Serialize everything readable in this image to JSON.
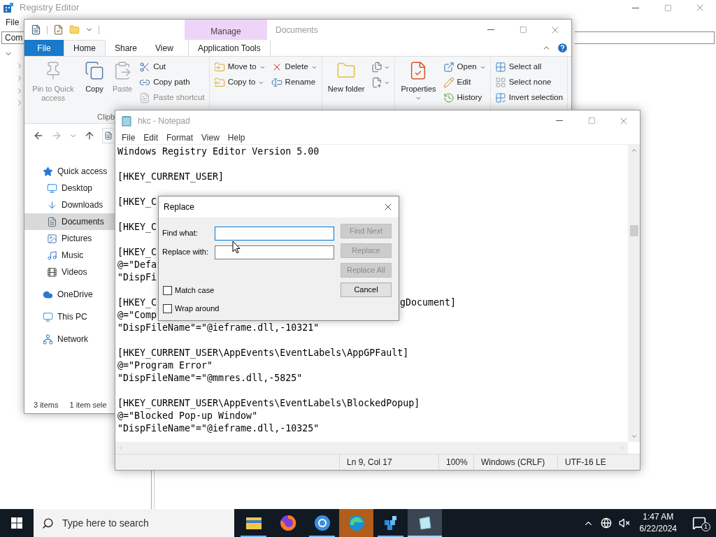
{
  "registry_editor": {
    "title": "Registry Editor",
    "menu": [
      "File"
    ],
    "address": "Com",
    "tree_expanders": [
      {
        "expanded": true
      },
      {
        "expanded": false
      },
      {
        "expanded": false
      },
      {
        "expanded": false
      },
      {
        "expanded": false
      }
    ]
  },
  "explorer": {
    "title": "Documents",
    "context_group": "Manage",
    "ribbon_tabs": [
      {
        "label": "File",
        "kind": "file",
        "selected": false
      },
      {
        "label": "Home",
        "kind": "tab",
        "selected": true
      },
      {
        "label": "Share",
        "kind": "tab",
        "selected": false
      },
      {
        "label": "View",
        "kind": "tab",
        "selected": false
      },
      {
        "label": "Application Tools",
        "kind": "context",
        "selected": false
      }
    ],
    "ribbon_groups": [
      {
        "label": "Clipb",
        "columns": [
          [
            {
              "label": "Pin to Quick access",
              "kind": "large",
              "disabled": true
            }
          ],
          [
            {
              "label": "Copy",
              "kind": "large",
              "disabled": false
            }
          ],
          [
            {
              "label": "Paste",
              "kind": "large",
              "disabled": true
            }
          ],
          [
            {
              "label": "Cut",
              "kind": "small",
              "disabled": false
            },
            {
              "label": "Copy path",
              "kind": "small",
              "disabled": false
            },
            {
              "label": "Paste shortcut",
              "kind": "small",
              "disabled": true
            }
          ]
        ]
      },
      {
        "columns": [
          [
            {
              "label": "Move to",
              "kind": "small",
              "dropdown": true,
              "disabled": false
            },
            {
              "label": "Copy to",
              "kind": "small",
              "dropdown": true,
              "disabled": false
            }
          ],
          [
            {
              "label": "Delete",
              "kind": "small",
              "dropdown": true,
              "disabled": false
            },
            {
              "label": "Rename",
              "kind": "small",
              "dropdown": false,
              "disabled": false
            }
          ]
        ]
      },
      {
        "columns": [
          [
            {
              "label": "New folder",
              "kind": "large",
              "disabled": false
            }
          ],
          [
            {
              "kind": "icon",
              "dropdown": true,
              "disabled": false
            },
            {
              "kind": "icon",
              "dropdown": true,
              "disabled": false
            }
          ]
        ]
      },
      {
        "columns": [
          [
            {
              "label": "Properties",
              "kind": "large",
              "dropdown": true,
              "disabled": false
            }
          ],
          [
            {
              "label": "Open",
              "kind": "small",
              "dropdown": true,
              "disabled": false
            },
            {
              "label": "Edit",
              "kind": "small",
              "dropdown": false,
              "disabled": false
            },
            {
              "label": "History",
              "kind": "small",
              "dropdown": false,
              "disabled": false
            }
          ]
        ]
      },
      {
        "columns": [
          [
            {
              "label": "Select all",
              "kind": "small",
              "disabled": false
            },
            {
              "label": "Select none",
              "kind": "small",
              "disabled": false
            },
            {
              "label": "Invert selection",
              "kind": "small",
              "disabled": false
            }
          ]
        ]
      }
    ],
    "sidebar": [
      {
        "label": "Quick access",
        "selected": false,
        "children": [
          {
            "label": "Desktop",
            "selected": false
          },
          {
            "label": "Downloads",
            "selected": false
          },
          {
            "label": "Documents",
            "selected": true
          },
          {
            "label": "Pictures",
            "selected": false
          },
          {
            "label": "Music",
            "selected": false
          },
          {
            "label": "Videos",
            "selected": false
          }
        ]
      },
      {
        "label": "OneDrive",
        "selected": false
      },
      {
        "label": "This PC",
        "selected": false
      },
      {
        "label": "Network",
        "selected": false
      }
    ],
    "status_bar": [
      "3 items",
      "1 item sele"
    ]
  },
  "notepad": {
    "title": "hkc - Notepad",
    "menu": [
      "File",
      "Edit",
      "Format",
      "View",
      "Help"
    ],
    "blocks": [
      [
        {
          "text": "Windows Registry Editor Version 5.00"
        }
      ],
      [
        {
          "text": "[HKEY_CURRENT_USER]"
        }
      ],
      [
        {
          "text": "[HKEY_C"
        }
      ],
      [
        {
          "text": "[HKEY_C"
        }
      ],
      [
        {
          "text": "[HKEY_C"
        },
        {
          "text": "@=\"Defa"
        },
        {
          "text": "\"DispFi"
        }
      ],
      [
        {
          "text": "[HKEY_C",
          "tail": "gDocument]"
        },
        {
          "text": "@=\"Comp"
        },
        {
          "text": "\"DispFileName\"=\"@ieframe.dll,-10321\""
        }
      ],
      [
        {
          "text": "[HKEY_CURRENT_USER\\AppEvents\\EventLabels\\AppGPFault]"
        },
        {
          "text": "@=\"Program Error\""
        },
        {
          "text": "\"DispFileName\"=\"@mmres.dll,-5825\""
        }
      ],
      [
        {
          "text": "[HKEY_CURRENT_USER\\AppEvents\\EventLabels\\BlockedPopup]"
        },
        {
          "text": "@=\"Blocked Pop-up Window\""
        },
        {
          "text": "\"DispFileName\"=\"@ieframe.dll,-10325\""
        }
      ]
    ],
    "status_bar": [
      "Ln 9, Col 17",
      "100%",
      "Windows (CRLF)",
      "UTF-16 LE"
    ]
  },
  "replace_dialog": {
    "title": "Replace",
    "fields": [
      {
        "label": "Find what:",
        "focused": true
      },
      {
        "label": "Replace with:",
        "focused": false
      }
    ],
    "buttons": [
      {
        "label": "Find Next",
        "disabled": true
      },
      {
        "label": "Replace",
        "disabled": true
      },
      {
        "label": "Replace All",
        "disabled": true
      },
      {
        "label": "Cancel",
        "disabled": false
      }
    ],
    "options": [
      {
        "label": "Match case",
        "checked": false
      },
      {
        "label": "Wrap around",
        "checked": false
      }
    ]
  },
  "taskbar": {
    "search_placeholder": "Type here to search",
    "apps": [
      {
        "running": true,
        "active": false,
        "flashing": false
      },
      {
        "running": false,
        "active": false,
        "flashing": false
      },
      {
        "running": true,
        "active": false,
        "flashing": false
      },
      {
        "running": false,
        "active": false,
        "flashing": true
      },
      {
        "running": true,
        "active": false,
        "flashing": false
      },
      {
        "running": true,
        "active": true,
        "flashing": false
      }
    ],
    "time": "1:47 AM",
    "date": "6/22/2024",
    "notification_count": "1"
  }
}
